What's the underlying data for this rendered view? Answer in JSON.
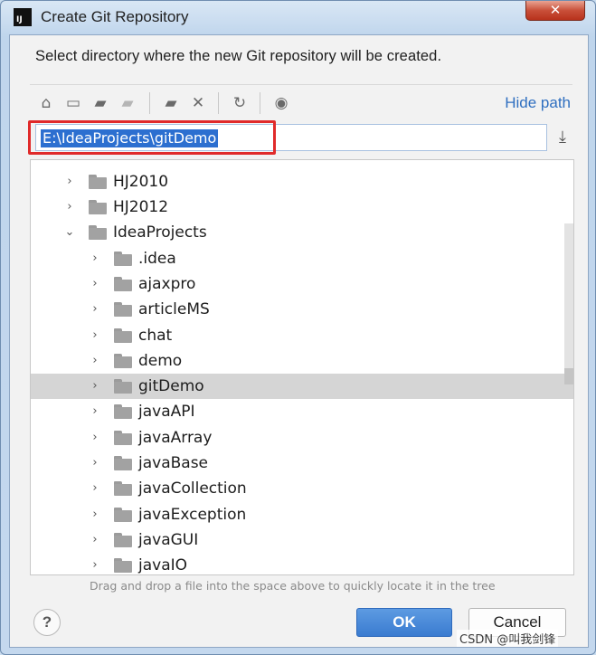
{
  "window": {
    "title": "Create Git Repository",
    "app_logo_text": "IJ",
    "close_glyph": "✕"
  },
  "prompt": "Select directory where the new Git repository will be created.",
  "toolbar": {
    "icons": [
      "home-icon",
      "desktop-icon",
      "project-folder-icon",
      "module-folder-icon",
      "new-folder-icon",
      "delete-icon",
      "refresh-icon",
      "show-hidden-icon"
    ],
    "hide_path_label": "Hide path"
  },
  "path": {
    "value": "E:\\IdeaProjects\\gitDemo"
  },
  "tree": {
    "items": [
      {
        "label": "HJ2010",
        "level": 0,
        "expanded": false,
        "selected": false
      },
      {
        "label": "HJ2012",
        "level": 0,
        "expanded": false,
        "selected": false
      },
      {
        "label": "IdeaProjects",
        "level": 0,
        "expanded": true,
        "selected": false
      },
      {
        "label": ".idea",
        "level": 1,
        "expanded": false,
        "selected": false
      },
      {
        "label": "ajaxpro",
        "level": 1,
        "expanded": false,
        "selected": false
      },
      {
        "label": "articleMS",
        "level": 1,
        "expanded": false,
        "selected": false
      },
      {
        "label": "chat",
        "level": 1,
        "expanded": false,
        "selected": false
      },
      {
        "label": "demo",
        "level": 1,
        "expanded": false,
        "selected": false
      },
      {
        "label": "gitDemo",
        "level": 1,
        "expanded": false,
        "selected": true
      },
      {
        "label": "javaAPI",
        "level": 1,
        "expanded": false,
        "selected": false
      },
      {
        "label": "javaArray",
        "level": 1,
        "expanded": false,
        "selected": false
      },
      {
        "label": "javaBase",
        "level": 1,
        "expanded": false,
        "selected": false
      },
      {
        "label": "javaCollection",
        "level": 1,
        "expanded": false,
        "selected": false
      },
      {
        "label": "javaException",
        "level": 1,
        "expanded": false,
        "selected": false
      },
      {
        "label": "javaGUI",
        "level": 1,
        "expanded": false,
        "selected": false
      },
      {
        "label": "javaIO",
        "level": 1,
        "expanded": false,
        "selected": false
      }
    ]
  },
  "hint": "Drag and drop a file into the space above to quickly locate it in the tree",
  "buttons": {
    "help_label": "?",
    "ok_label": "OK",
    "cancel_label": "Cancel"
  },
  "watermark": "CSDN @叫我剑锋",
  "colors": {
    "accent": "#3a7bd0",
    "selection": "#2c6fd0",
    "highlight_border": "#e02a2a",
    "link": "#2f6fc0"
  }
}
